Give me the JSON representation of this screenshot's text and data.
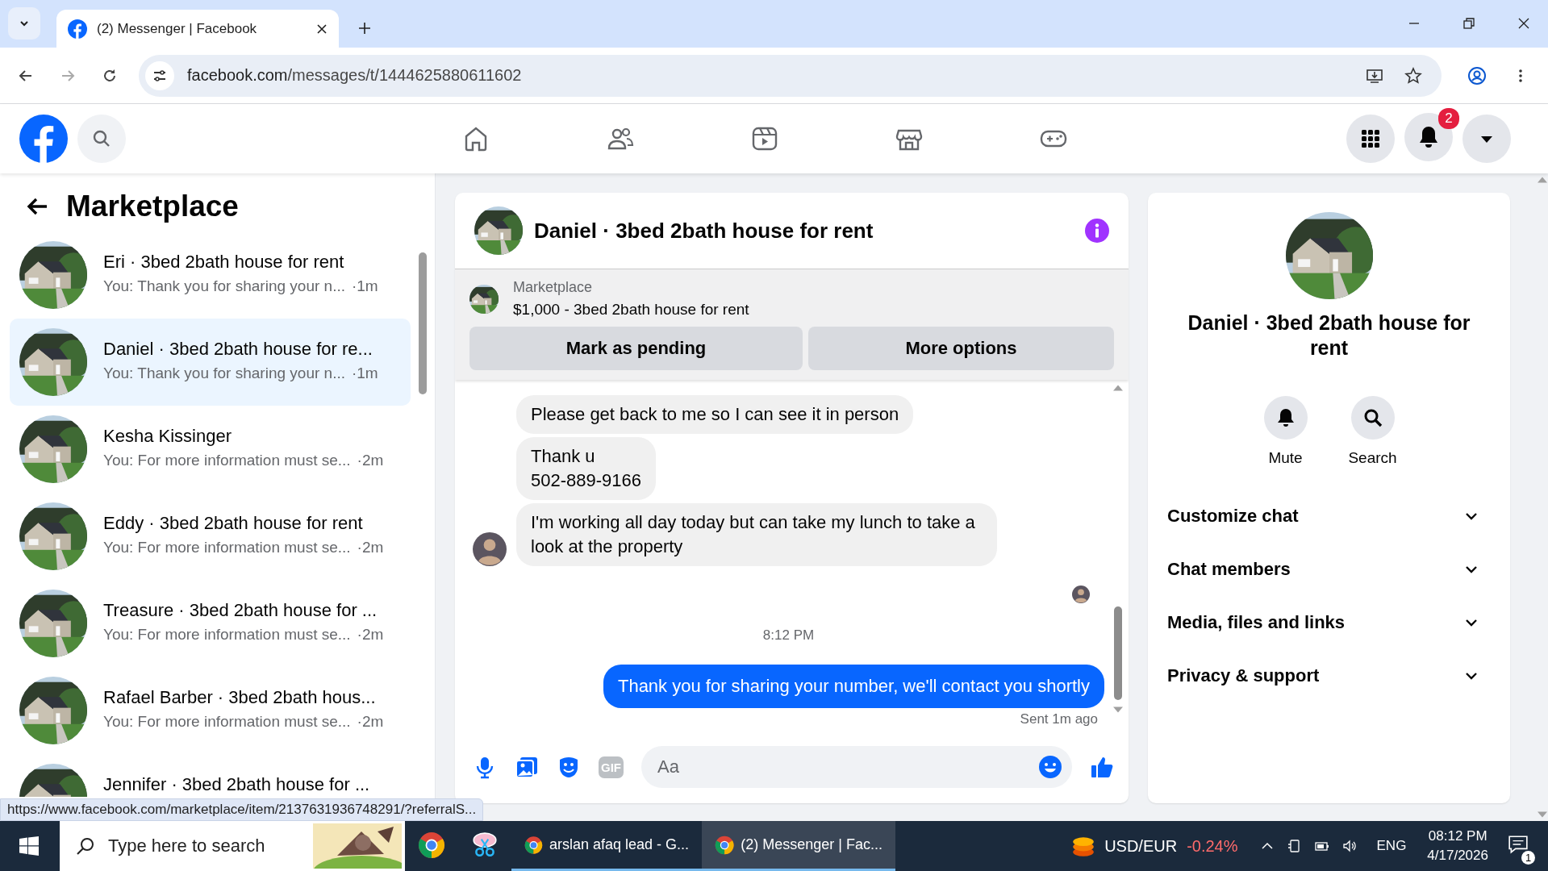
{
  "browser": {
    "tab_title": "(2) Messenger | Facebook",
    "url_host": "facebook.com",
    "url_path": "/messages/t/1444625880611602"
  },
  "header": {
    "notification_count": "2"
  },
  "sidebar": {
    "title": "Marketplace",
    "conversations": [
      {
        "name": "Eri · 3bed 2bath house for rent",
        "preview": "You: Thank you for sharing your n...",
        "time": "·1m",
        "selected": false
      },
      {
        "name": "Daniel · 3bed 2bath house for re...",
        "preview": "You: Thank you for sharing your n...",
        "time": "·1m",
        "selected": true
      },
      {
        "name": "Kesha Kissinger",
        "preview": "You: For more information must se...",
        "time": "·2m",
        "selected": false
      },
      {
        "name": "Eddy · 3bed 2bath house for rent",
        "preview": "You: For more information must se...",
        "time": "·2m",
        "selected": false
      },
      {
        "name": "Treasure · 3bed 2bath house for ...",
        "preview": "You: For more information must se...",
        "time": "·2m",
        "selected": false
      },
      {
        "name": "Rafael Barber · 3bed 2bath hous...",
        "preview": "You: For more information must se...",
        "time": "·2m",
        "selected": false
      },
      {
        "name": "Jennifer · 3bed 2bath house for ...",
        "selected": false
      }
    ]
  },
  "chat": {
    "title": "Daniel · 3bed 2bath house for rent",
    "listing": {
      "source": "Marketplace",
      "summary": "$1,000 - 3bed 2bath house for rent"
    },
    "actions": [
      "Mark as pending",
      "More options"
    ],
    "messages": [
      {
        "kind": "incoming",
        "lines": [
          "Please get back to me so I can see it in person"
        ],
        "avatar": false
      },
      {
        "kind": "incoming",
        "lines": [
          "Thank u",
          "502-889-9166"
        ],
        "avatar": false
      },
      {
        "kind": "incoming",
        "lines": [
          "I'm working all day today but can take my lunch to take a look at the property"
        ],
        "avatar": true
      },
      {
        "kind": "receipt"
      },
      {
        "kind": "time",
        "text": "8:12 PM"
      },
      {
        "kind": "outgoing",
        "lines": [
          "Thank you for sharing your number, we'll contact you shortly"
        ]
      },
      {
        "kind": "status",
        "text": "Sent 1m ago"
      }
    ],
    "composer": {
      "placeholder": "Aa",
      "gif_label": "GIF"
    }
  },
  "details": {
    "title": "Daniel · 3bed 2bath house for rent",
    "actions": [
      {
        "kind": "mute",
        "label": "Mute"
      },
      {
        "kind": "search",
        "label": "Search"
      }
    ],
    "sections": [
      "Customize chat",
      "Chat members",
      "Media, files and links",
      "Privacy & support"
    ]
  },
  "status_url": "https://www.facebook.com/marketplace/item/2137631936748291/?referralS...",
  "taskbar": {
    "search_placeholder": "Type here to search",
    "apps": [
      {
        "kind": "chrome",
        "selected": false
      },
      {
        "kind": "snip",
        "selected": false
      },
      {
        "kind": "chrome-window",
        "label": "arslan afaq lead - G...",
        "selected": false
      },
      {
        "kind": "chrome-window",
        "label": "(2) Messenger | Fac...",
        "selected": true
      }
    ],
    "ticker": {
      "name": "USD/EUR",
      "change": "-0.24%"
    },
    "language": "ENG",
    "time": "08:12 PM",
    "date": "4/17/2026",
    "notifications": "1"
  }
}
